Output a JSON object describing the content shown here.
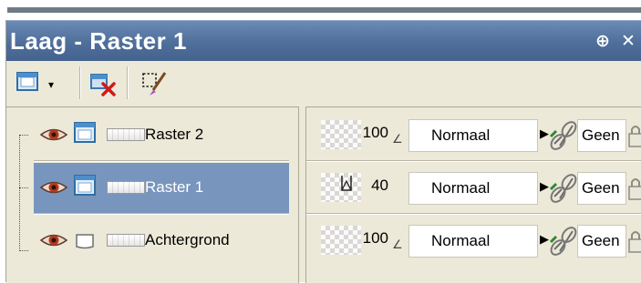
{
  "palette": {
    "title": "Laag - Raster 1",
    "pin_glyph": "⊕",
    "close_glyph": "✕",
    "toolbar": {
      "tools": [
        {
          "icon": "new-layer-icon",
          "dropdown_glyph": "▾"
        },
        {
          "icon": "delete-layer-icon"
        },
        {
          "icon": "edit-selection-icon"
        }
      ]
    }
  },
  "layers": [
    {
      "name": "Raster 2",
      "selected": false,
      "opacity": "100",
      "blend_mode": "Normaal",
      "link": "Geen",
      "icons": [
        "eye-icon",
        "raster-layer-icon"
      ]
    },
    {
      "name": "Raster 1",
      "selected": true,
      "opacity": "40",
      "blend_mode": "Normaal",
      "link": "Geen",
      "icons": [
        "eye-icon",
        "raster-layer-icon"
      ]
    },
    {
      "name": "Achtergrond",
      "selected": false,
      "opacity": "100",
      "blend_mode": "Normaal",
      "link": "Geen",
      "icons": [
        "eye-icon",
        "background-layer-icon"
      ]
    }
  ],
  "glyphs": {
    "dropdown_arrow": "▶",
    "resize_corner": "∠"
  },
  "colors": {
    "title_bar": "#4f6f9b",
    "selected_row": "#7895bd",
    "panel_bg": "#ece9d8",
    "visibility_eye": "#b23a1b"
  }
}
